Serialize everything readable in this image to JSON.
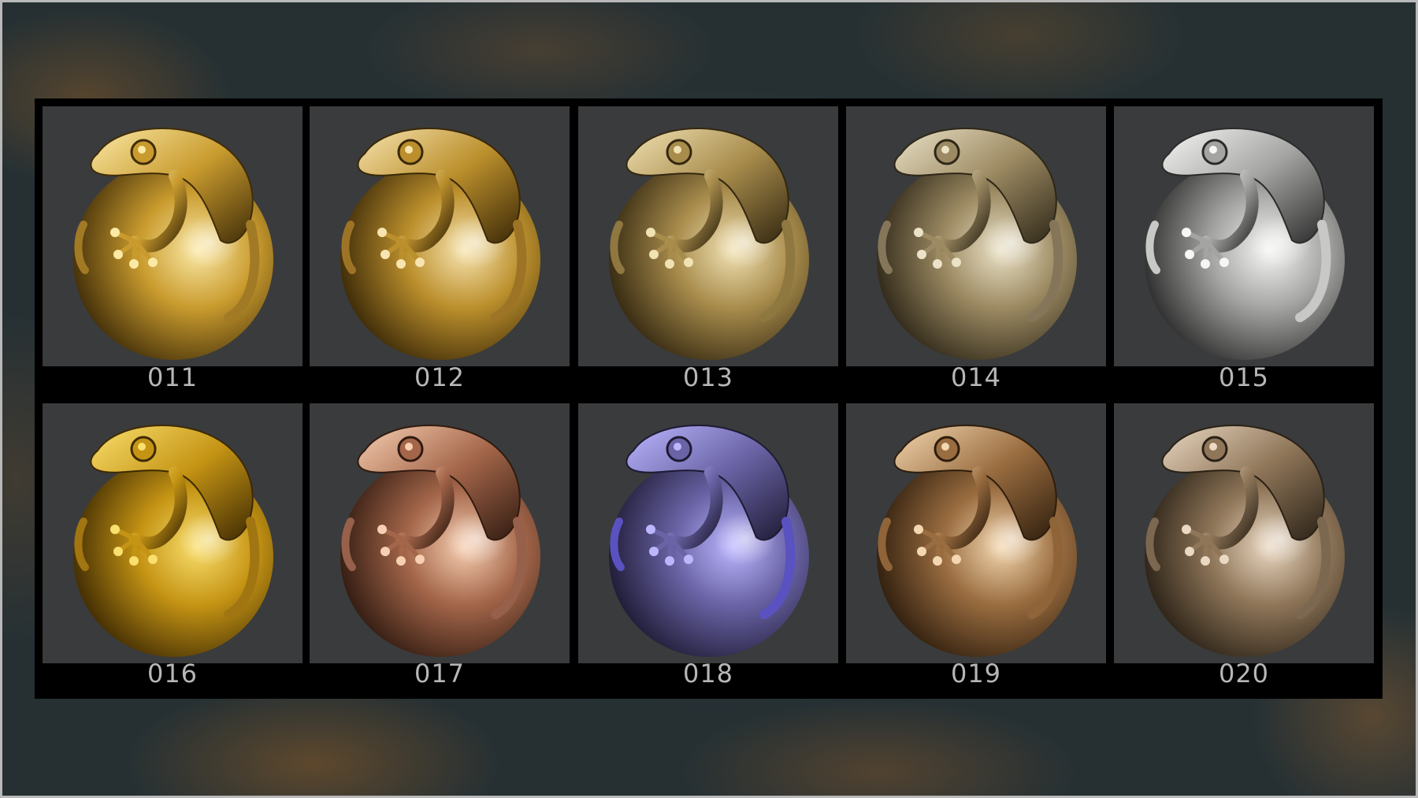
{
  "swatches": [
    {
      "label": "011",
      "colors": {
        "light": "#fbe9a6",
        "mid": "#c99b2e",
        "dark": "#3f2c08",
        "rim": "#a27a25"
      }
    },
    {
      "label": "012",
      "colors": {
        "light": "#f7e4b0",
        "mid": "#bb8f2c",
        "dark": "#3a2807",
        "rim": "#9d7426"
      }
    },
    {
      "label": "013",
      "colors": {
        "light": "#f1e2b4",
        "mid": "#a88c4c",
        "dark": "#332710",
        "rim": "#8f7740"
      }
    },
    {
      "label": "014",
      "colors": {
        "light": "#ebe2c8",
        "mid": "#9c8a62",
        "dark": "#2e2718",
        "rim": "#85765a"
      }
    },
    {
      "label": "015",
      "colors": {
        "light": "#f6f6f4",
        "mid": "#a4a4a2",
        "dark": "#2b2b2b",
        "rim": "#c8c8c6"
      }
    },
    {
      "label": "016",
      "colors": {
        "light": "#f9df6e",
        "mid": "#c59414",
        "dark": "#3e2a03",
        "rim": "#a17512"
      }
    },
    {
      "label": "017",
      "colors": {
        "light": "#f7cfb2",
        "mid": "#a4664a",
        "dark": "#301a10",
        "rim": "#96604a"
      }
    },
    {
      "label": "018",
      "colors": {
        "light": "#bcb6ff",
        "mid": "#6a64a6",
        "dark": "#1d1a33",
        "rim": "#5a52c0"
      }
    },
    {
      "label": "019",
      "colors": {
        "light": "#f3d7b0",
        "mid": "#9a6d40",
        "dark": "#2e1d0d",
        "rim": "#8f6438"
      }
    },
    {
      "label": "020",
      "colors": {
        "light": "#ead8c2",
        "mid": "#8f7659",
        "dark": "#2a2116",
        "rim": "#7c6750"
      }
    }
  ]
}
